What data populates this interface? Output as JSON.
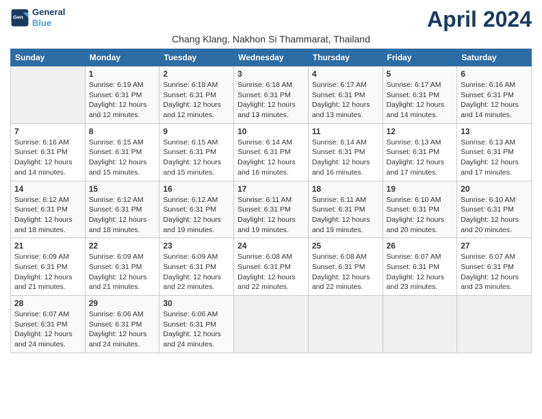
{
  "logo": {
    "line1": "General",
    "line2": "Blue"
  },
  "title": "April 2024",
  "subtitle": "Chang Klang, Nakhon Si Thammarat, Thailand",
  "days_header": [
    "Sunday",
    "Monday",
    "Tuesday",
    "Wednesday",
    "Thursday",
    "Friday",
    "Saturday"
  ],
  "weeks": [
    [
      {
        "day": "",
        "info": ""
      },
      {
        "day": "1",
        "info": "Sunrise: 6:19 AM\nSunset: 6:31 PM\nDaylight: 12 hours\nand 12 minutes."
      },
      {
        "day": "2",
        "info": "Sunrise: 6:18 AM\nSunset: 6:31 PM\nDaylight: 12 hours\nand 12 minutes."
      },
      {
        "day": "3",
        "info": "Sunrise: 6:18 AM\nSunset: 6:31 PM\nDaylight: 12 hours\nand 13 minutes."
      },
      {
        "day": "4",
        "info": "Sunrise: 6:17 AM\nSunset: 6:31 PM\nDaylight: 12 hours\nand 13 minutes."
      },
      {
        "day": "5",
        "info": "Sunrise: 6:17 AM\nSunset: 6:31 PM\nDaylight: 12 hours\nand 14 minutes."
      },
      {
        "day": "6",
        "info": "Sunrise: 6:16 AM\nSunset: 6:31 PM\nDaylight: 12 hours\nand 14 minutes."
      }
    ],
    [
      {
        "day": "7",
        "info": "Sunrise: 6:16 AM\nSunset: 6:31 PM\nDaylight: 12 hours\nand 14 minutes."
      },
      {
        "day": "8",
        "info": "Sunrise: 6:15 AM\nSunset: 6:31 PM\nDaylight: 12 hours\nand 15 minutes."
      },
      {
        "day": "9",
        "info": "Sunrise: 6:15 AM\nSunset: 6:31 PM\nDaylight: 12 hours\nand 15 minutes."
      },
      {
        "day": "10",
        "info": "Sunrise: 6:14 AM\nSunset: 6:31 PM\nDaylight: 12 hours\nand 16 minutes."
      },
      {
        "day": "11",
        "info": "Sunrise: 6:14 AM\nSunset: 6:31 PM\nDaylight: 12 hours\nand 16 minutes."
      },
      {
        "day": "12",
        "info": "Sunrise: 6:13 AM\nSunset: 6:31 PM\nDaylight: 12 hours\nand 17 minutes."
      },
      {
        "day": "13",
        "info": "Sunrise: 6:13 AM\nSunset: 6:31 PM\nDaylight: 12 hours\nand 17 minutes."
      }
    ],
    [
      {
        "day": "14",
        "info": "Sunrise: 6:12 AM\nSunset: 6:31 PM\nDaylight: 12 hours\nand 18 minutes."
      },
      {
        "day": "15",
        "info": "Sunrise: 6:12 AM\nSunset: 6:31 PM\nDaylight: 12 hours\nand 18 minutes."
      },
      {
        "day": "16",
        "info": "Sunrise: 6:12 AM\nSunset: 6:31 PM\nDaylight: 12 hours\nand 19 minutes."
      },
      {
        "day": "17",
        "info": "Sunrise: 6:11 AM\nSunset: 6:31 PM\nDaylight: 12 hours\nand 19 minutes."
      },
      {
        "day": "18",
        "info": "Sunrise: 6:11 AM\nSunset: 6:31 PM\nDaylight: 12 hours\nand 19 minutes."
      },
      {
        "day": "19",
        "info": "Sunrise: 6:10 AM\nSunset: 6:31 PM\nDaylight: 12 hours\nand 20 minutes."
      },
      {
        "day": "20",
        "info": "Sunrise: 6:10 AM\nSunset: 6:31 PM\nDaylight: 12 hours\nand 20 minutes."
      }
    ],
    [
      {
        "day": "21",
        "info": "Sunrise: 6:09 AM\nSunset: 6:31 PM\nDaylight: 12 hours\nand 21 minutes."
      },
      {
        "day": "22",
        "info": "Sunrise: 6:09 AM\nSunset: 6:31 PM\nDaylight: 12 hours\nand 21 minutes."
      },
      {
        "day": "23",
        "info": "Sunrise: 6:09 AM\nSunset: 6:31 PM\nDaylight: 12 hours\nand 22 minutes."
      },
      {
        "day": "24",
        "info": "Sunrise: 6:08 AM\nSunset: 6:31 PM\nDaylight: 12 hours\nand 22 minutes."
      },
      {
        "day": "25",
        "info": "Sunrise: 6:08 AM\nSunset: 6:31 PM\nDaylight: 12 hours\nand 22 minutes."
      },
      {
        "day": "26",
        "info": "Sunrise: 6:07 AM\nSunset: 6:31 PM\nDaylight: 12 hours\nand 23 minutes."
      },
      {
        "day": "27",
        "info": "Sunrise: 6:07 AM\nSunset: 6:31 PM\nDaylight: 12 hours\nand 23 minutes."
      }
    ],
    [
      {
        "day": "28",
        "info": "Sunrise: 6:07 AM\nSunset: 6:31 PM\nDaylight: 12 hours\nand 24 minutes."
      },
      {
        "day": "29",
        "info": "Sunrise: 6:06 AM\nSunset: 6:31 PM\nDaylight: 12 hours\nand 24 minutes."
      },
      {
        "day": "30",
        "info": "Sunrise: 6:06 AM\nSunset: 6:31 PM\nDaylight: 12 hours\nand 24 minutes."
      },
      {
        "day": "",
        "info": ""
      },
      {
        "day": "",
        "info": ""
      },
      {
        "day": "",
        "info": ""
      },
      {
        "day": "",
        "info": ""
      }
    ]
  ]
}
